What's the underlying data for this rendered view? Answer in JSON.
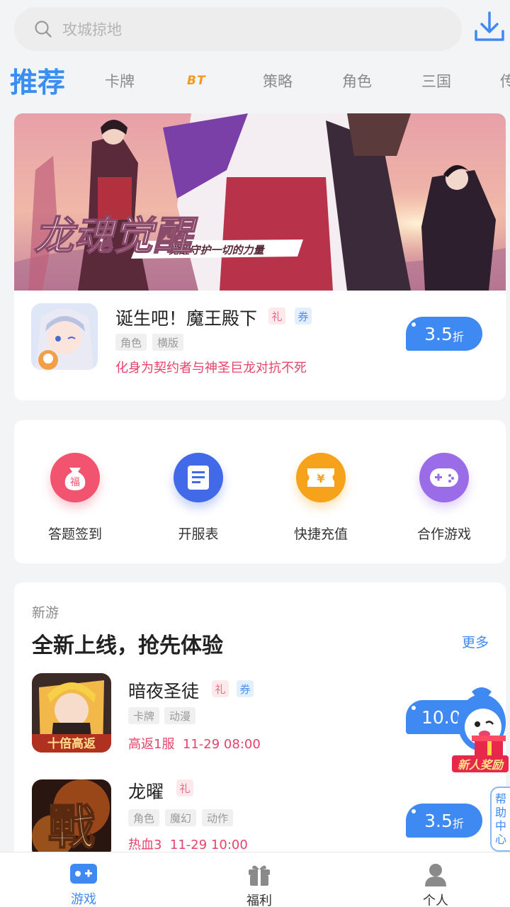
{
  "search": {
    "placeholder": "攻城掠地"
  },
  "tabs": [
    {
      "label": "推荐"
    },
    {
      "label": "卡牌"
    },
    {
      "label": "BT"
    },
    {
      "label": "策略"
    },
    {
      "label": "角色"
    },
    {
      "label": "三国"
    },
    {
      "label": "传"
    }
  ],
  "featured": {
    "banner_title": "龙魂觉醒",
    "banner_slogan": "觉醒守护一切的力量",
    "title": "诞生吧！魔王殿下",
    "gift_badge": "礼",
    "coupon_badge": "券",
    "tags": [
      "角色",
      "横版"
    ],
    "description": "化身为契约者与神圣巨龙对抗不死",
    "discount": "3.5",
    "discount_unit": "折"
  },
  "quick_actions": [
    {
      "label": "答题签到",
      "icon": "lucky-bag-icon",
      "glyph": "福",
      "color": "#f2546f"
    },
    {
      "label": "开服表",
      "icon": "document-list-icon",
      "color": "#4169e8"
    },
    {
      "label": "快捷充值",
      "icon": "recharge-ticket-icon",
      "glyph": "¥",
      "color": "#f7a21b"
    },
    {
      "label": "合作游戏",
      "icon": "gamepad-icon",
      "color": "#9a6ce8"
    }
  ],
  "new_games": {
    "section_tag": "新游",
    "title": "全新上线，抢先体验",
    "more": "更多",
    "items": [
      {
        "title": "暗夜圣徒",
        "gift_badge": "礼",
        "coupon_badge": "券",
        "tags": [
          "卡牌",
          "动漫"
        ],
        "server": "高返1服",
        "time": "11-29 08:00",
        "discount": "10.0",
        "icon_text": "十倍高返"
      },
      {
        "title": "龙曜",
        "gift_badge": "礼",
        "tags": [
          "角色",
          "魔幻",
          "动作"
        ],
        "server": "热血3",
        "time": "11-29 10:00",
        "discount": "3.5",
        "discount_unit": "折",
        "icon_text": "戰"
      }
    ]
  },
  "floating": {
    "reward_label": "新人奖励",
    "help_label": "帮助中心"
  },
  "bottom_nav": [
    {
      "label": "游戏",
      "icon": "gamepad-icon",
      "active": true
    },
    {
      "label": "福利",
      "icon": "gift-icon",
      "active": false
    },
    {
      "label": "个人",
      "icon": "user-icon",
      "active": false
    }
  ],
  "colors": {
    "accent": "#3f8af2",
    "highlight": "#e8436a",
    "bt": "#f39a1d"
  }
}
